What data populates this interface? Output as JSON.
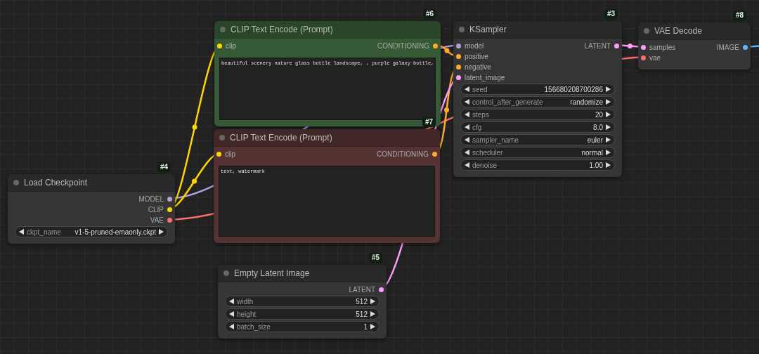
{
  "nodes": [
    {
      "title": "CLIP Text Encode (Prompt)",
      "badge": "#6",
      "color": "#355a35",
      "inputs": [
        {
          "label": "clip",
          "color": "#ffd500"
        }
      ],
      "outputs": [
        {
          "label": "CONDITIONING",
          "color": "#ffa931"
        }
      ],
      "prompt": "beautiful scenery nature glass bottle landscape, , purple galaxy bottle,"
    },
    {
      "title": "KSampler",
      "badge": "#3",
      "color": "#353535",
      "inputs": [
        {
          "label": "model",
          "color": "#b39ddb"
        },
        {
          "label": "positive",
          "color": "#ffa931"
        },
        {
          "label": "negative",
          "color": "#ffa931"
        },
        {
          "label": "latent_image",
          "color": "#ff9cf9"
        }
      ],
      "outputs": [
        {
          "label": "LATENT",
          "color": "#ff9cf9"
        }
      ],
      "widgets": [
        {
          "name": "seed",
          "value": "156680208700286"
        },
        {
          "name": "control_after_generate",
          "value": "randomize"
        },
        {
          "name": "steps",
          "value": "20"
        },
        {
          "name": "cfg",
          "value": "8.0"
        },
        {
          "name": "sampler_name",
          "value": "euler"
        },
        {
          "name": "scheduler",
          "value": "normal"
        },
        {
          "name": "denoise",
          "value": "1.00"
        }
      ]
    },
    {
      "title": "VAE Decode",
      "badge": "#8",
      "color": "#353535",
      "inputs": [
        {
          "label": "samples",
          "color": "#ff9cf9"
        },
        {
          "label": "vae",
          "color": "#ff6e6e"
        }
      ],
      "outputs": [
        {
          "label": "IMAGE",
          "color": "#64b5f6"
        }
      ]
    },
    {
      "title": "CLIP Text Encode (Prompt)",
      "badge": "#7",
      "color": "#553333",
      "inputs": [
        {
          "label": "clip",
          "color": "#ffd500"
        }
      ],
      "outputs": [
        {
          "label": "CONDITIONING",
          "color": "#ffa931"
        }
      ],
      "prompt": "text, watermark"
    },
    {
      "title": "Load Checkpoint",
      "badge": "#4",
      "color": "#353535",
      "outputs": [
        {
          "label": "MODEL",
          "color": "#b39ddb"
        },
        {
          "label": "CLIP",
          "color": "#ffd500"
        },
        {
          "label": "VAE",
          "color": "#ff6e6e"
        }
      ],
      "widgets": [
        {
          "name": "ckpt_name",
          "value": "v1-5-pruned-emaonly.ckpt"
        }
      ]
    },
    {
      "title": "Empty Latent Image",
      "badge": "#5",
      "color": "#353535",
      "outputs": [
        {
          "label": "LATENT",
          "color": "#ff9cf9"
        }
      ],
      "widgets": [
        {
          "name": "width",
          "value": "512"
        },
        {
          "name": "height",
          "value": "512"
        },
        {
          "name": "batch_size",
          "value": "1"
        }
      ]
    }
  ]
}
